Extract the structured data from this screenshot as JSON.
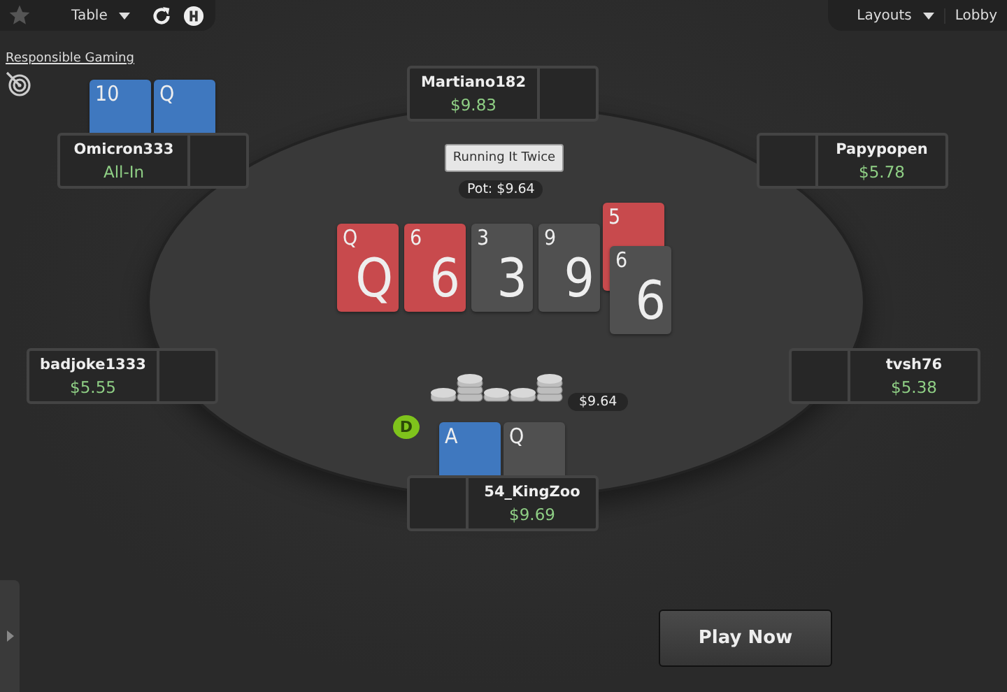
{
  "top_bar": {
    "table_menu": "Table",
    "layouts_menu": "Layouts",
    "lobby": "Lobby"
  },
  "responsible_gaming": "Responsible Gaming",
  "seats": [
    {
      "name": "Martiano182",
      "stack": "$9.83"
    },
    {
      "name": "Omicron333",
      "stack": "All-In",
      "cards": [
        {
          "rank": "10",
          "color": "#3f78bf"
        },
        {
          "rank": "Q",
          "color": "#3f78bf"
        }
      ]
    },
    {
      "name": "Papypopen",
      "stack": "$5.78"
    },
    {
      "name": "badjoke1333",
      "stack": "$5.55"
    },
    {
      "name": "tvsh76",
      "stack": "$5.38"
    },
    {
      "name": "54_KingZoo",
      "stack": "$9.69",
      "cards": [
        {
          "rank": "A",
          "color": "#3f78bf"
        },
        {
          "rank": "Q",
          "color": "#505050"
        }
      ]
    }
  ],
  "board": {
    "run_label": "Running It Twice",
    "pot": "Pot: $9.64",
    "cards": [
      {
        "rank": "Q",
        "center_rank": "Q",
        "color": "#c84a4d"
      },
      {
        "rank": "6",
        "center_rank": "6",
        "color": "#c84a4d"
      },
      {
        "rank": "3",
        "center_rank": "3",
        "color": "#505050"
      },
      {
        "rank": "9",
        "center_rank": "9",
        "color": "#505050"
      }
    ],
    "second_run": [
      {
        "rank": "5",
        "color": "#c84a4d"
      },
      {
        "rank": "6",
        "center_rank": "6",
        "color": "#505050"
      }
    ]
  },
  "bet": "$9.64",
  "dealer": "D",
  "play_now": "Play Now"
}
